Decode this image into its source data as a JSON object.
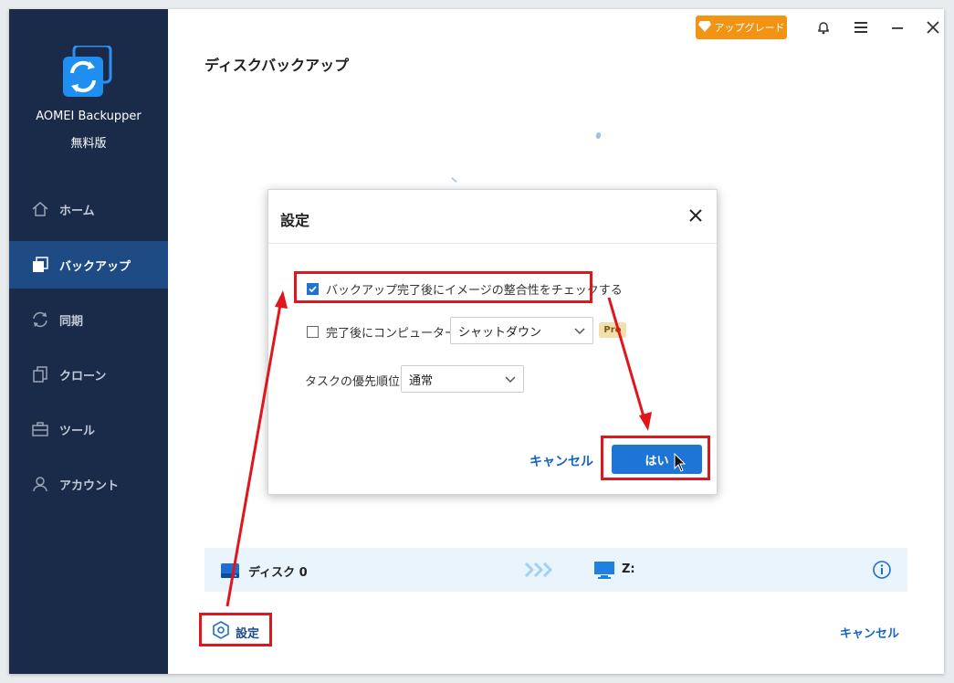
{
  "app": {
    "name": "AOMEI Backupper",
    "edition": "無料版"
  },
  "sidebar": {
    "items": [
      {
        "label": "ホーム",
        "icon": "home-icon",
        "active": false
      },
      {
        "label": "バックアップ",
        "icon": "backup-icon",
        "active": true
      },
      {
        "label": "同期",
        "icon": "sync-icon",
        "active": false
      },
      {
        "label": "クローン",
        "icon": "clone-icon",
        "active": false
      },
      {
        "label": "ツール",
        "icon": "tools-icon",
        "active": false
      },
      {
        "label": "アカウント",
        "icon": "account-icon",
        "active": false
      }
    ]
  },
  "titlebar": {
    "upgrade_label": "アップグレード"
  },
  "main": {
    "page_title": "ディスクバックアップ",
    "source_label": "ディスク 0",
    "destination_label": "Z:",
    "settings_label": "設定",
    "cancel_label": "キャンセル"
  },
  "dialog": {
    "title": "設定",
    "verify_label": "バックアップ完了後にイメージの整合性をチェックする",
    "verify_checked": true,
    "shutdown_label": "完了後にコンピューターを",
    "shutdown_checked": false,
    "shutdown_select": "シャットダウン",
    "pro_badge": "Pro",
    "priority_label": "タスクの優先順位",
    "priority_select": "通常",
    "cancel_label": "キャンセル",
    "ok_label": "はい"
  },
  "colors": {
    "sidebar_bg": "#1a2b4a",
    "sidebar_active": "#1e4b84",
    "accent_blue": "#1f75d6",
    "upgrade_orange": "#f39314",
    "highlight_red": "#e0161d"
  }
}
